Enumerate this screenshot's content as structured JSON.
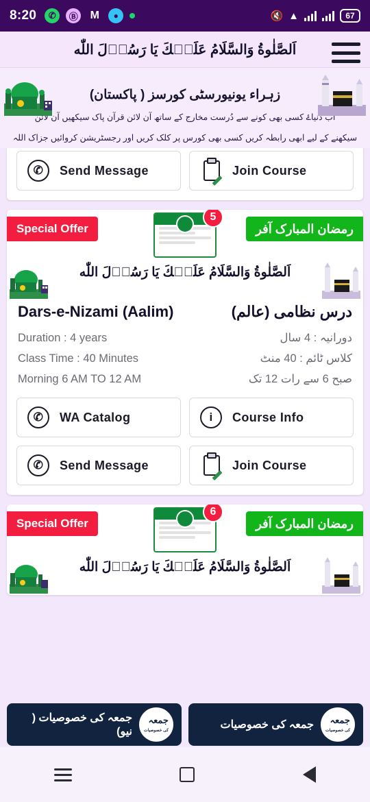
{
  "status_bar": {
    "time": "8:20",
    "battery": "67",
    "icons": [
      "whatsapp-icon",
      "b-app-icon",
      "gmail-icon",
      "messenger-icon",
      "green-dot-icon",
      "mute-icon",
      "wifi-icon",
      "signal-1-icon",
      "signal-2-icon"
    ]
  },
  "app_header": {
    "title": "اَلصَّلٰوةُ وَالسَّلَامُ عَلَيۡكَ يَا رَسُوۡلَ اللّٰه",
    "menu_icon": "hamburger-icon"
  },
  "banner": {
    "title": "زہراء یونیورسٹی کورسز ( پاکستان)",
    "subtitle_line1": "اب دُنیاۓ کسی بھی کونے سے دُرست مخارج کے ساتھ آن لائن قرآن پاک سیکھیں آن لائن",
    "subtitle_line2": "سیکھنے کے لیے ابھی رابطہ کریں کسی بھی کورس پر کلک کریں اور رجسٹریشن کروائیں جزاک اللہ خیرا",
    "left_icon": "mosque-icon",
    "right_icon": "kaaba-icon"
  },
  "cards": [
    {
      "buttons": [
        {
          "label": "Send Message",
          "icon": "whatsapp-icon"
        },
        {
          "label": "Join Course",
          "icon": "clipboard-icon"
        }
      ]
    },
    {
      "offer_left": "Special Offer",
      "offer_right": "رمضان المبارک آفر",
      "badge_number": "5",
      "durood": "اَلصَّلٰوةُ وَالسَّلَامُ عَلَيۡكَ يَا رَسُوۡلَ اللّٰه",
      "title_en": "Dars-e-Nizami (Aalim)",
      "title_ur": "درس نظامی (عالم)",
      "info": [
        {
          "en": "Duration : 4 years",
          "ur": "دورانیہ : 4 سال"
        },
        {
          "en": "Class Time : 40 Minutes",
          "ur": "کلاس ٹائم : 40 منٹ"
        },
        {
          "en": "Morning 6 AM TO 12 AM",
          "ur": "صبح 6 سے رات 12 تک"
        }
      ],
      "buttons": [
        {
          "label": "WA Catalog",
          "icon": "whatsapp-icon"
        },
        {
          "label": "Course Info",
          "icon": "info-icon"
        },
        {
          "label": "Send Message",
          "icon": "whatsapp-icon"
        },
        {
          "label": "Join Course",
          "icon": "clipboard-icon"
        }
      ]
    },
    {
      "offer_left": "Special Offer",
      "offer_right": "رمضان المبارک آفر",
      "badge_number": "6",
      "durood": "اَلصَّلٰوةُ وَالسَّلَامُ عَلَيۡكَ يَا رَسُوۡلَ اللّٰه"
    }
  ],
  "bottom_bar": {
    "left_button": "جمعہ کی خصوصیات ( نیو)",
    "right_button": "جمعہ کی خصوصیات",
    "seal_text": "جمعہ",
    "seal_sub": "کی خصوصیات"
  },
  "navbar": {
    "items": [
      "recents-icon",
      "home-icon",
      "back-icon"
    ]
  },
  "colors": {
    "status_bar": "#3b0a5e",
    "offer_red": "#f21d3f",
    "offer_green": "#12b61a",
    "page_bg": "#f3e8fb",
    "bottom_bar": "#12233f"
  }
}
